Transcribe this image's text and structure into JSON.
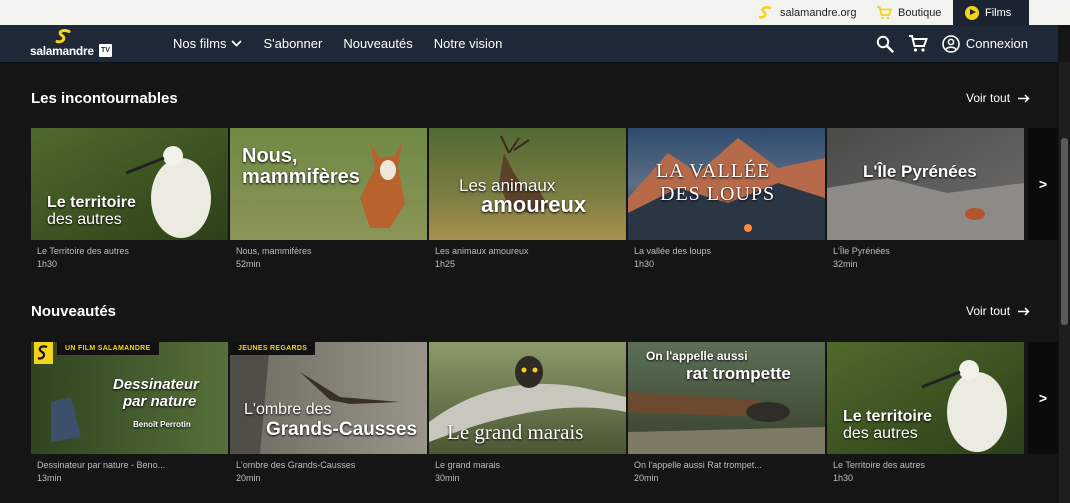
{
  "topbar": {
    "site_label": "salamandre.org",
    "shop_label": "Boutique",
    "films_label": "Films"
  },
  "nav": {
    "brand_word": "salamandre",
    "brand_tv": "TV",
    "links": [
      "Nos films",
      "S'abonner",
      "Nouveautés",
      "Notre vision"
    ],
    "login_label": "Connexion"
  },
  "sections": [
    {
      "title": "Les incontournables",
      "see_all": "Voir tout",
      "next_label": ">",
      "cards": [
        {
          "title": "Le Territoire des autres",
          "duration": "1h30",
          "overlay": [
            "Le territoire",
            "des autres"
          ]
        },
        {
          "title": "Nous, mammifères",
          "duration": "52min",
          "overlay": [
            "Nous,",
            "mammifères"
          ]
        },
        {
          "title": "Les animaux amoureux",
          "duration": "1h25",
          "overlay": [
            "Les animaux",
            "amoureux"
          ]
        },
        {
          "title": "La vallée des loups",
          "duration": "1h30",
          "overlay": [
            "LA VALLÉE",
            "DES LOUPS"
          ]
        },
        {
          "title": "L'Île Pyrénées",
          "duration": "32min",
          "overlay": [
            "L'Île Pyrénées"
          ]
        }
      ]
    },
    {
      "title": "Nouveautés",
      "see_all": "Voir tout",
      "next_label": ">",
      "cards": [
        {
          "title": "Dessinateur par nature - Beno...",
          "duration": "13min",
          "tag": "UN FILM SALAMANDRE",
          "overlay": [
            "Dessinateur",
            "par nature",
            "Benoît Perrotin"
          ]
        },
        {
          "title": "L'ombre des Grands-Causses",
          "duration": "20min",
          "tag": "JEUNES REGARDS",
          "overlay": [
            "L'ombre des",
            "Grands-Causses"
          ]
        },
        {
          "title": "Le grand marais",
          "duration": "30min",
          "overlay": [
            "Le grand marais"
          ]
        },
        {
          "title": "On l'appelle aussi Rat trompet...",
          "duration": "20min",
          "overlay": [
            "On l'appelle aussi",
            "rat trompette"
          ]
        },
        {
          "title": "Le Territoire des autres",
          "duration": "1h30",
          "overlay": [
            "Le territoire",
            "des autres"
          ]
        }
      ]
    }
  ],
  "colors": {
    "accent_yellow": "#f5d21c",
    "nav_bg": "#1f2836",
    "page_bg": "#151515"
  }
}
